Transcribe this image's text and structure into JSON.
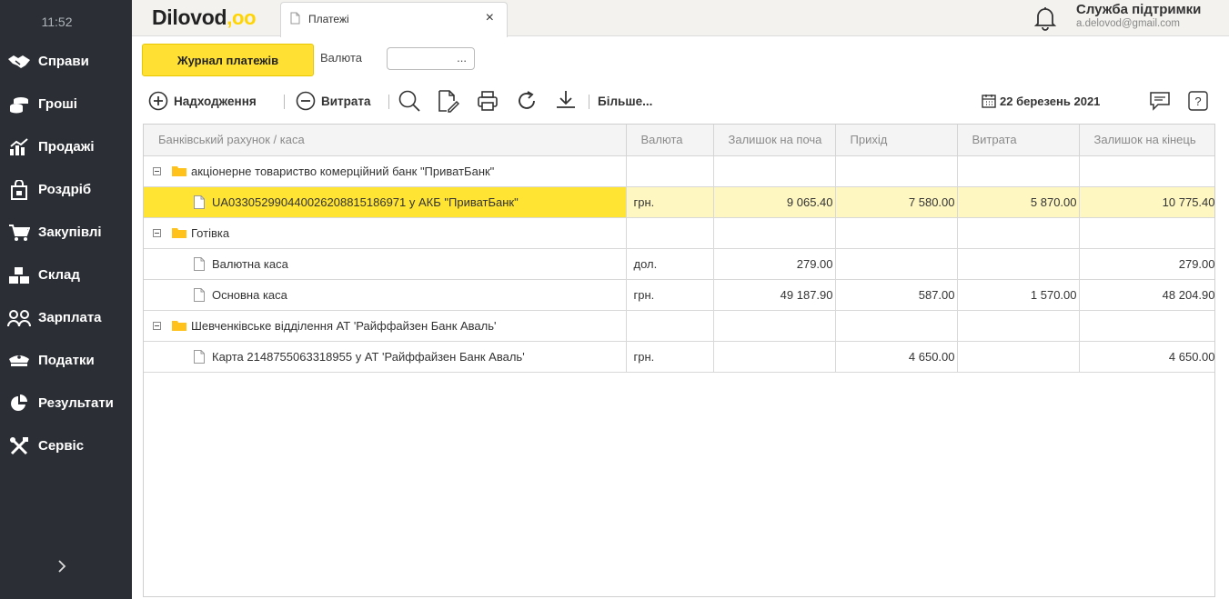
{
  "sidebar": {
    "clock": "11:52",
    "items": [
      {
        "label": "Справи",
        "icon": "handshake-icon"
      },
      {
        "label": "Гроші",
        "icon": "coins-icon"
      },
      {
        "label": "Продажі",
        "icon": "chart-bars-icon"
      },
      {
        "label": "Роздріб",
        "icon": "shopping-bag-icon"
      },
      {
        "label": "Закупівлі",
        "icon": "cart-icon"
      },
      {
        "label": "Склад",
        "icon": "boxes-icon"
      },
      {
        "label": "Зарплата",
        "icon": "people-icon"
      },
      {
        "label": "Податки",
        "icon": "officer-cap-icon"
      },
      {
        "label": "Результати",
        "icon": "pie-chart-icon"
      },
      {
        "label": "Сервіс",
        "icon": "tools-icon"
      }
    ]
  },
  "header": {
    "logo_text": "Dilovod",
    "logo_suffix": ",oo",
    "tab_label": "Платежі",
    "tab_close": "×",
    "support_title": "Служба підтримки",
    "support_email": "a.delovod@gmail.com"
  },
  "controls": {
    "journal_button": "Журнал платежів",
    "currency_label": "Валюта",
    "currency_value": "...",
    "income_label": "Надходження",
    "expense_label": "Витрата",
    "more_label": "Більше...",
    "date": "22 березень 2021"
  },
  "table": {
    "columns": [
      "Банківський рахунок / каса",
      "Валюта",
      "Залишок на поча",
      "Прихід",
      "Витрата",
      "Залишок на кінець"
    ],
    "rows": [
      {
        "type": "group",
        "name": "акціонерне товариство комерційний банк \"ПриватБанк\"",
        "currency": "",
        "start": "",
        "income": "",
        "expense": "",
        "end": "",
        "selected": false
      },
      {
        "type": "item",
        "name": "UA033052990440026208815186971 у АКБ \"ПриватБанк\"",
        "currency": "грн.",
        "start": "9 065.40",
        "income": "7 580.00",
        "expense": "5 870.00",
        "end": "10 775.40",
        "selected": true
      },
      {
        "type": "group",
        "name": "Готівка",
        "currency": "",
        "start": "",
        "income": "",
        "expense": "",
        "end": "",
        "selected": false
      },
      {
        "type": "item",
        "name": "Валютна каса",
        "currency": "дол.",
        "start": "279.00",
        "income": "",
        "expense": "",
        "end": "279.00",
        "selected": false
      },
      {
        "type": "item",
        "name": "Основна каса",
        "currency": "грн.",
        "start": "49 187.90",
        "income": "587.00",
        "expense": "1 570.00",
        "end": "48 204.90",
        "selected": false
      },
      {
        "type": "group",
        "name": "Шевченківське відділення АТ 'Райффайзен Банк Аваль'",
        "currency": "",
        "start": "",
        "income": "",
        "expense": "",
        "end": "",
        "selected": false
      },
      {
        "type": "item",
        "name": "Карта 2148755063318955 у АТ 'Райффайзен Банк Аваль'",
        "currency": "грн.",
        "start": "",
        "income": "4 650.00",
        "expense": "",
        "end": "4 650.00",
        "selected": false
      }
    ]
  },
  "colors": {
    "sidebar_bg": "#2b2f35",
    "accent": "#ffe033",
    "selected_row": "#fff7c2"
  }
}
